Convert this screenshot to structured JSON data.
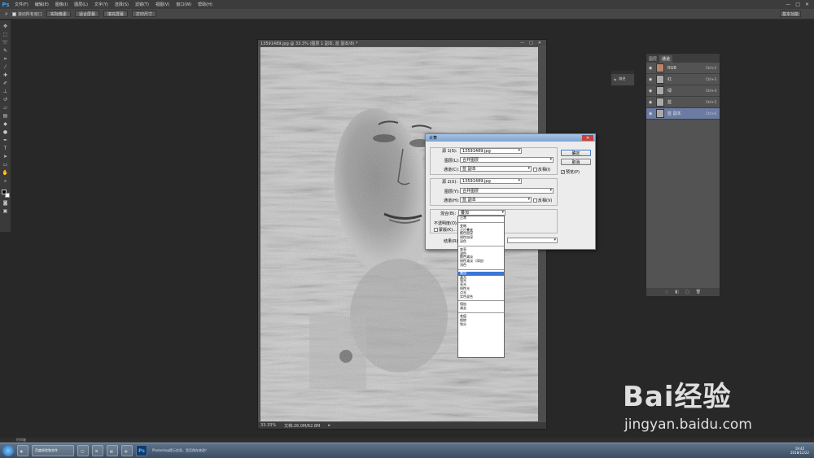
{
  "app": {
    "logo": "Ps"
  },
  "menubar": {
    "items": [
      "文件(F)",
      "编辑(E)",
      "图像(I)",
      "图层(L)",
      "文字(Y)",
      "选择(S)",
      "滤镜(T)",
      "视图(V)",
      "窗口(W)",
      "帮助(H)"
    ],
    "window_controls": [
      "—",
      "□",
      "✕"
    ]
  },
  "options": {
    "check_label": "滚动所有窗口",
    "buttons": [
      "实际像素",
      "适合屏幕",
      "填充屏幕",
      "打印尺寸"
    ],
    "workspace": "基本功能"
  },
  "document": {
    "title": "13591489.jpg @ 33.3% (图层 1 副本, 蓝 副本/8) *",
    "zoom": "33.33%",
    "file_info": "文档:26.0M/62.8M"
  },
  "mini_panel": {
    "label": "路径"
  },
  "channels_panel": {
    "tabs": [
      "图层",
      "通道"
    ],
    "active_tab": "通道",
    "rows": [
      {
        "name": "RGB",
        "key": "Ctrl+2"
      },
      {
        "name": "红",
        "key": "Ctrl+3"
      },
      {
        "name": "绿",
        "key": "Ctrl+4"
      },
      {
        "name": "蓝",
        "key": "Ctrl+5"
      },
      {
        "name": "蓝 副本",
        "key": "Ctrl+6"
      }
    ],
    "selected_row": "蓝 副本"
  },
  "dialog": {
    "title": "计算",
    "source1": {
      "source_label": "源 1(S):",
      "source_value": "13591489.jpg",
      "layer_label": "图层(L):",
      "layer_value": "合并图层",
      "channel_label": "通道(C):",
      "channel_value": "蓝 副本",
      "invert_label": "反相(I)"
    },
    "source2": {
      "source_label": "源 2(U):",
      "source_value": "13591489.jpg",
      "layer_label": "图层(Y):",
      "layer_value": "合并图层",
      "channel_label": "通道(H):",
      "channel_value": "蓝 副本",
      "invert_label": "反相(V)"
    },
    "blend_label": "混合(B):",
    "blend_value": "叠加",
    "opacity_label": "不透明度(O):",
    "mask_label": "蒙版(K)...",
    "result_label": "结果(R):",
    "ok_label": "确定",
    "cancel_label": "取消",
    "preview_label": "预览(P)"
  },
  "blend_list": {
    "groups": [
      [
        "正常"
      ],
      [
        "变暗",
        "正片叠底",
        "颜色加深",
        "线性加深",
        "深色"
      ],
      [
        "变亮",
        "滤色",
        "颜色减淡",
        "线性减淡（添加）",
        "浅色"
      ],
      [
        "叠加",
        "柔光",
        "强光",
        "亮光",
        "线性光",
        "点光",
        "实色混合"
      ],
      [
        "相加",
        "减去"
      ],
      [
        "差值",
        "相除",
        "划分"
      ]
    ],
    "selected": "叠加"
  },
  "bottom_strip": "时间轴",
  "taskbar": {
    "items": [
      "百度经验和文件",
      "",
      "",
      "",
      "",
      ""
    ],
    "ps_label": "Ps",
    "notice": "Photoshop提示信息，是否保存修改？",
    "time": "19:42",
    "date": "2018/12/22"
  },
  "watermark": {
    "brand": "Bai经验",
    "url": "jingyan.baidu.com"
  }
}
